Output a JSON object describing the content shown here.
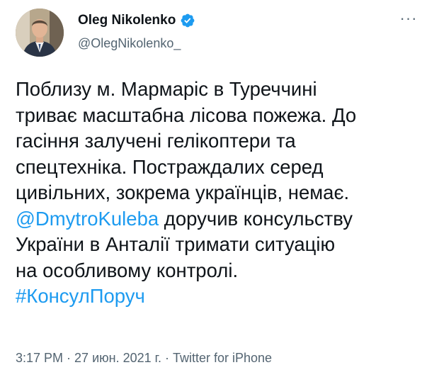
{
  "author": {
    "display_name": "Oleg Nikolenko",
    "handle": "@OlegNikolenko_",
    "verified": true
  },
  "more_label": "···",
  "tweet": {
    "line1": "Поблизу м. Мармаріс в Туреччині",
    "line2": "триває масштабна лісова пожежа. До",
    "line3": "гасіння залучені гелікоптери та",
    "line4": "спецтехніка. Постраждалих серед",
    "line5": "цивільних, зокрема українців, немає.",
    "mention": "@DmytroKuleba",
    "line6_rest": " доручив консульству",
    "line7": "України в Анталії тримати ситуацію",
    "line8": "на особливому контролі.",
    "hashtag": "#КонсулПоруч"
  },
  "meta": {
    "time": "3:17 PM",
    "separator": " · ",
    "date": "27 июн. 2021 г.",
    "source": "Twitter for iPhone"
  },
  "colors": {
    "link": "#1d9bf0",
    "text": "#0f1419",
    "secondary": "#536471",
    "verified": "#1d9bf0"
  }
}
